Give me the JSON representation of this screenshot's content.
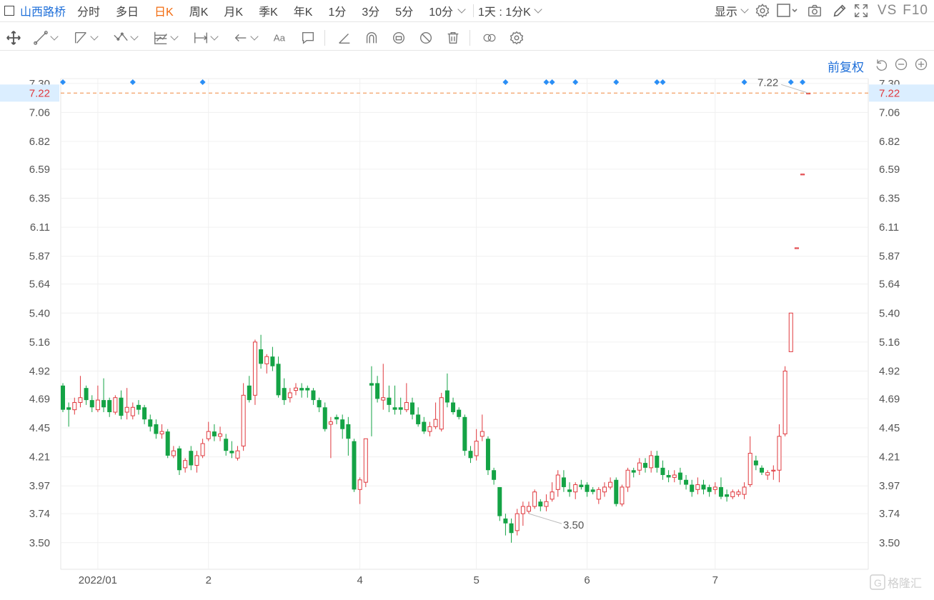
{
  "topbar": {
    "stock_name": "山西路桥",
    "periods": [
      "分时",
      "多日",
      "日K",
      "周K",
      "月K",
      "季K",
      "年K",
      "1分",
      "3分",
      "5分",
      "10分"
    ],
    "active_period": "日K",
    "range_label": "1天 : 1分K",
    "display_label": "显示",
    "vs_label": "VS",
    "f10_label": "F10"
  },
  "adjust": {
    "label": "前复权"
  },
  "chart_data": {
    "type": "candlestick",
    "y_ticks": [
      7.3,
      7.06,
      6.82,
      6.59,
      6.35,
      6.11,
      5.87,
      5.64,
      5.4,
      5.16,
      4.92,
      4.69,
      4.45,
      4.21,
      3.97,
      3.74,
      3.5
    ],
    "y_tick_labels": [
      "7.30",
      "7.06",
      "6.82",
      "6.59",
      "6.35",
      "6.11",
      "5.87",
      "5.64",
      "5.40",
      "5.16",
      "4.92",
      "4.69",
      "4.45",
      "4.21",
      "3.97",
      "3.74",
      "3.50"
    ],
    "ylim": [
      3.28,
      7.34
    ],
    "x_labels": [
      "2022/01",
      "2",
      "4",
      "5",
      "6",
      "7"
    ],
    "x_label_days": [
      6,
      25,
      51,
      71,
      90,
      112
    ],
    "current_price": 7.22,
    "current_price_label": "7.22",
    "max_annotation": "7.22",
    "min_annotation": "3.50",
    "min_day": 80,
    "event_marker_days": [
      0,
      12,
      24,
      76,
      83,
      84,
      88,
      95,
      102,
      103,
      117,
      125,
      127
    ],
    "up_color": "#e0393e",
    "down_color": "#14a345",
    "candles": [
      [
        4.8,
        4.6,
        4.82,
        4.58
      ],
      [
        4.62,
        4.6,
        4.66,
        4.46
      ],
      [
        4.6,
        4.66,
        4.7,
        4.56
      ],
      [
        4.66,
        4.7,
        4.88,
        4.62
      ],
      [
        4.78,
        4.68,
        4.8,
        4.64
      ],
      [
        4.68,
        4.62,
        4.72,
        4.58
      ],
      [
        4.6,
        4.68,
        4.8,
        4.58
      ],
      [
        4.68,
        4.62,
        4.86,
        4.58
      ],
      [
        4.68,
        4.58,
        4.7,
        4.54
      ],
      [
        4.58,
        4.7,
        4.72,
        4.56
      ],
      [
        4.7,
        4.55,
        4.76,
        4.52
      ],
      [
        4.58,
        4.62,
        4.78,
        4.52
      ],
      [
        4.55,
        4.62,
        4.66,
        4.52
      ],
      [
        4.64,
        4.6,
        4.68,
        4.56
      ],
      [
        4.62,
        4.52,
        4.64,
        4.48
      ],
      [
        4.52,
        4.46,
        4.56,
        4.42
      ],
      [
        4.48,
        4.4,
        4.52,
        4.36
      ],
      [
        4.4,
        4.42,
        4.48,
        4.36
      ],
      [
        4.42,
        4.22,
        4.44,
        4.2
      ],
      [
        4.22,
        4.26,
        4.3,
        4.2
      ],
      [
        4.28,
        4.1,
        4.3,
        4.06
      ],
      [
        4.12,
        4.18,
        4.2,
        4.08
      ],
      [
        4.26,
        4.14,
        4.3,
        4.1
      ],
      [
        4.14,
        4.22,
        4.26,
        4.08
      ],
      [
        4.22,
        4.32,
        4.36,
        4.2
      ],
      [
        4.36,
        4.42,
        4.5,
        4.34
      ],
      [
        4.42,
        4.38,
        4.48,
        4.34
      ],
      [
        4.38,
        4.4,
        4.46,
        4.34
      ],
      [
        4.36,
        4.26,
        4.4,
        4.22
      ],
      [
        4.26,
        4.24,
        4.34,
        4.2
      ],
      [
        4.2,
        4.26,
        4.3,
        4.18
      ],
      [
        4.3,
        4.72,
        4.82,
        4.26
      ],
      [
        4.8,
        4.68,
        4.88,
        4.66
      ],
      [
        4.72,
        5.16,
        5.18,
        4.64
      ],
      [
        5.1,
        4.98,
        5.22,
        4.94
      ],
      [
        4.98,
        5.04,
        5.06,
        4.9
      ],
      [
        5.04,
        4.96,
        5.12,
        4.92
      ],
      [
        4.98,
        4.72,
        5.04,
        4.7
      ],
      [
        4.78,
        4.68,
        4.86,
        4.64
      ],
      [
        4.7,
        4.74,
        4.78,
        4.66
      ],
      [
        4.76,
        4.78,
        4.82,
        4.72
      ],
      [
        4.78,
        4.76,
        4.82,
        4.7
      ],
      [
        4.78,
        4.76,
        4.8,
        4.7
      ],
      [
        4.76,
        4.68,
        4.78,
        4.64
      ],
      [
        4.68,
        4.62,
        4.7,
        4.58
      ],
      [
        4.62,
        4.44,
        4.66,
        4.42
      ],
      [
        4.48,
        4.5,
        4.54,
        4.2
      ],
      [
        4.54,
        4.52,
        4.56,
        4.48
      ],
      [
        4.52,
        4.44,
        4.56,
        4.36
      ],
      [
        4.48,
        4.36,
        4.54,
        4.22
      ],
      [
        4.34,
        3.94,
        4.36,
        3.92
      ],
      [
        3.94,
        4.02,
        4.04,
        3.82
      ],
      [
        4.0,
        4.36,
        4.36,
        3.96
      ],
      [
        4.82,
        4.8,
        4.96,
        4.38
      ],
      [
        4.82,
        4.69,
        4.88,
        4.66
      ],
      [
        4.68,
        4.7,
        4.98,
        4.6
      ],
      [
        4.7,
        4.64,
        4.8,
        4.58
      ],
      [
        4.62,
        4.6,
        4.8,
        4.56
      ],
      [
        4.62,
        4.6,
        4.7,
        4.56
      ],
      [
        4.6,
        4.66,
        4.82,
        4.58
      ],
      [
        4.66,
        4.56,
        4.7,
        4.52
      ],
      [
        4.56,
        4.48,
        4.62,
        4.46
      ],
      [
        4.5,
        4.42,
        4.54,
        4.4
      ],
      [
        4.42,
        4.46,
        4.5,
        4.38
      ],
      [
        4.46,
        4.52,
        4.66,
        4.44
      ],
      [
        4.44,
        4.7,
        4.74,
        4.42
      ],
      [
        4.76,
        4.66,
        4.9,
        4.62
      ],
      [
        4.66,
        4.58,
        4.7,
        4.56
      ],
      [
        4.6,
        4.54,
        4.62,
        4.52
      ],
      [
        4.54,
        4.26,
        4.56,
        4.22
      ],
      [
        4.26,
        4.2,
        4.3,
        4.16
      ],
      [
        4.22,
        4.34,
        4.44,
        4.18
      ],
      [
        4.38,
        4.42,
        4.56,
        4.34
      ],
      [
        4.36,
        4.1,
        4.38,
        4.06
      ],
      [
        4.1,
        4.02,
        4.12,
        3.98
      ],
      [
        3.96,
        3.72,
        3.96,
        3.68
      ],
      [
        3.7,
        3.66,
        3.74,
        3.56
      ],
      [
        3.66,
        3.58,
        3.7,
        3.5
      ],
      [
        3.6,
        3.74,
        3.78,
        3.56
      ],
      [
        3.74,
        3.8,
        3.84,
        3.64
      ],
      [
        3.76,
        3.8,
        3.84,
        3.74
      ],
      [
        3.8,
        3.92,
        3.94,
        3.78
      ],
      [
        3.84,
        3.8,
        3.86,
        3.76
      ],
      [
        3.8,
        3.84,
        3.9,
        3.76
      ],
      [
        3.86,
        3.92,
        4.0,
        3.84
      ],
      [
        3.94,
        4.06,
        4.1,
        3.88
      ],
      [
        4.04,
        3.96,
        4.1,
        3.92
      ],
      [
        3.94,
        3.92,
        4.0,
        3.88
      ],
      [
        3.92,
        3.98,
        4.0,
        3.86
      ],
      [
        3.98,
        3.96,
        4.02,
        3.94
      ],
      [
        3.98,
        3.92,
        4.0,
        3.88
      ],
      [
        3.94,
        3.92,
        3.96,
        3.9
      ],
      [
        3.86,
        3.94,
        3.96,
        3.82
      ],
      [
        3.92,
        3.96,
        4.0,
        3.88
      ],
      [
        3.96,
        4.0,
        4.04,
        3.94
      ],
      [
        4.02,
        3.82,
        4.04,
        3.8
      ],
      [
        3.82,
        3.96,
        3.98,
        3.8
      ],
      [
        3.96,
        4.1,
        4.12,
        3.92
      ],
      [
        4.1,
        4.08,
        4.12,
        4.04
      ],
      [
        4.1,
        4.16,
        4.2,
        4.06
      ],
      [
        4.16,
        4.12,
        4.2,
        4.08
      ],
      [
        4.12,
        4.22,
        4.26,
        4.08
      ],
      [
        4.22,
        4.12,
        4.26,
        4.08
      ],
      [
        4.12,
        4.06,
        4.18,
        4.02
      ],
      [
        4.06,
        4.04,
        4.1,
        4.0
      ],
      [
        4.04,
        4.06,
        4.1,
        4.0
      ],
      [
        4.08,
        4.02,
        4.12,
        3.98
      ],
      [
        4.02,
        3.98,
        4.06,
        3.94
      ],
      [
        3.98,
        3.92,
        4.02,
        3.88
      ],
      [
        3.94,
        3.98,
        4.04,
        3.9
      ],
      [
        3.98,
        3.94,
        4.02,
        3.9
      ],
      [
        3.96,
        3.92,
        3.98,
        3.88
      ],
      [
        3.94,
        3.96,
        4.0,
        3.9
      ],
      [
        3.96,
        3.88,
        4.04,
        3.86
      ],
      [
        3.9,
        3.88,
        3.94,
        3.84
      ],
      [
        3.88,
        3.92,
        3.94,
        3.86
      ],
      [
        3.9,
        3.92,
        3.94,
        3.88
      ],
      [
        3.9,
        3.96,
        4.0,
        3.86
      ],
      [
        3.98,
        4.24,
        4.38,
        3.96
      ],
      [
        4.18,
        4.14,
        4.22,
        4.1
      ],
      [
        4.12,
        4.08,
        4.14,
        4.06
      ],
      [
        4.06,
        4.08,
        4.1,
        4.02
      ],
      [
        4.1,
        4.1,
        4.14,
        4.02
      ],
      [
        4.1,
        4.38,
        4.48,
        4.0
      ],
      [
        4.4,
        4.92,
        4.96,
        4.38
      ],
      [
        5.08,
        5.4,
        5.4,
        5.08
      ],
      [
        5.94,
        5.94,
        5.94,
        5.94
      ],
      [
        6.55,
        6.55,
        6.55,
        6.55
      ],
      [
        7.22,
        7.22,
        7.22,
        7.22
      ]
    ]
  }
}
